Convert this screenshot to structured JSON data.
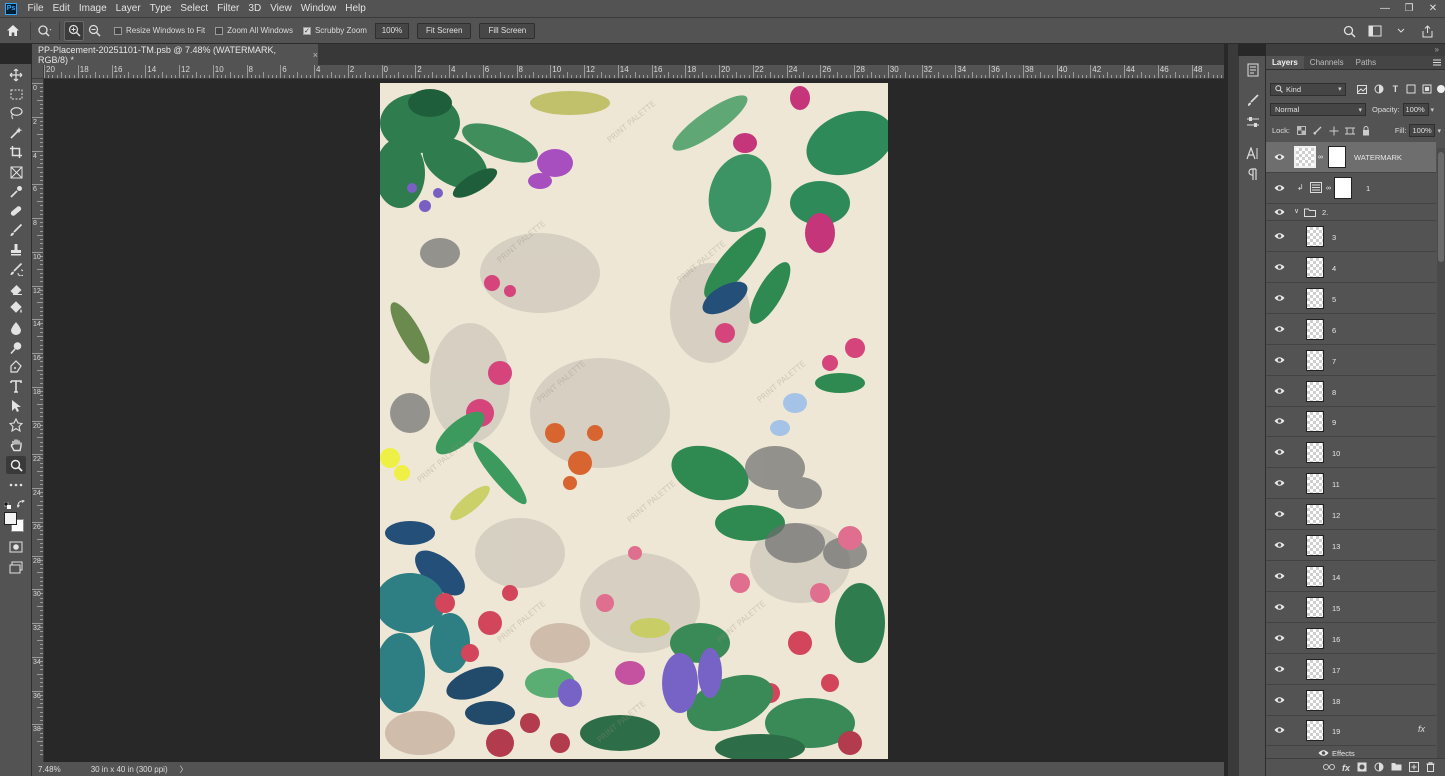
{
  "menubar": {
    "logo": "Ps",
    "items": [
      "File",
      "Edit",
      "Image",
      "Layer",
      "Type",
      "Select",
      "Filter",
      "3D",
      "View",
      "Window",
      "Help"
    ]
  },
  "options": {
    "resize_windows_label": "Resize Windows to Fit",
    "zoom_all_label": "Zoom All Windows",
    "scrubby_label": "Scrubby Zoom",
    "scrubby_checked": true,
    "zoom_value": "100%",
    "fit_screen": "Fit Screen",
    "fill_screen": "Fill Screen"
  },
  "document": {
    "tab_title": "PP-Placement-20251101-TM.psb @ 7.48% (WATERMARK, RGB/8) *",
    "tab_close": "×",
    "background_color": "#f5efe2"
  },
  "rulers": {
    "horizontal_labels": [
      "20",
      "18",
      "16",
      "14",
      "12",
      "10",
      "8",
      "6",
      "4",
      "2",
      "0",
      "2",
      "4",
      "6",
      "8",
      "10",
      "12",
      "14",
      "16",
      "18",
      "20",
      "22",
      "24",
      "26",
      "28",
      "30",
      "32",
      "34",
      "36",
      "38",
      "40",
      "42",
      "44",
      "46",
      "48"
    ],
    "vertical_labels": [
      "0",
      "2",
      "4",
      "6",
      "8",
      "10",
      "12",
      "14",
      "16",
      "18",
      "20",
      "22",
      "24",
      "26",
      "28",
      "30",
      "32",
      "34",
      "36",
      "38"
    ]
  },
  "status": {
    "zoom": "7.48%",
    "doc_size": "30 in x 40 in (300 ppi)",
    "arrow": "〉"
  },
  "layers_panel": {
    "tabs": [
      "Layers",
      "Channels",
      "Paths"
    ],
    "active_tab": "Layers",
    "filter_kind": "Kind",
    "blend_mode": "Normal",
    "opacity_label": "Opacity:",
    "opacity_value": "100%",
    "lock_label": "Lock:",
    "fill_label": "Fill:",
    "fill_value": "100%",
    "layers": [
      {
        "name": "WATERMARK",
        "type": "smart",
        "selected": true
      },
      {
        "name": "1",
        "type": "adjust"
      },
      {
        "name": "2.",
        "type": "group"
      },
      {
        "name": "3"
      },
      {
        "name": "4"
      },
      {
        "name": "5"
      },
      {
        "name": "6"
      },
      {
        "name": "7"
      },
      {
        "name": "8"
      },
      {
        "name": "9"
      },
      {
        "name": "10"
      },
      {
        "name": "11"
      },
      {
        "name": "12"
      },
      {
        "name": "13"
      },
      {
        "name": "14"
      },
      {
        "name": "15"
      },
      {
        "name": "16"
      },
      {
        "name": "17"
      },
      {
        "name": "18"
      },
      {
        "name": "19",
        "fx": "fx"
      }
    ],
    "effects_label": "Effects"
  }
}
